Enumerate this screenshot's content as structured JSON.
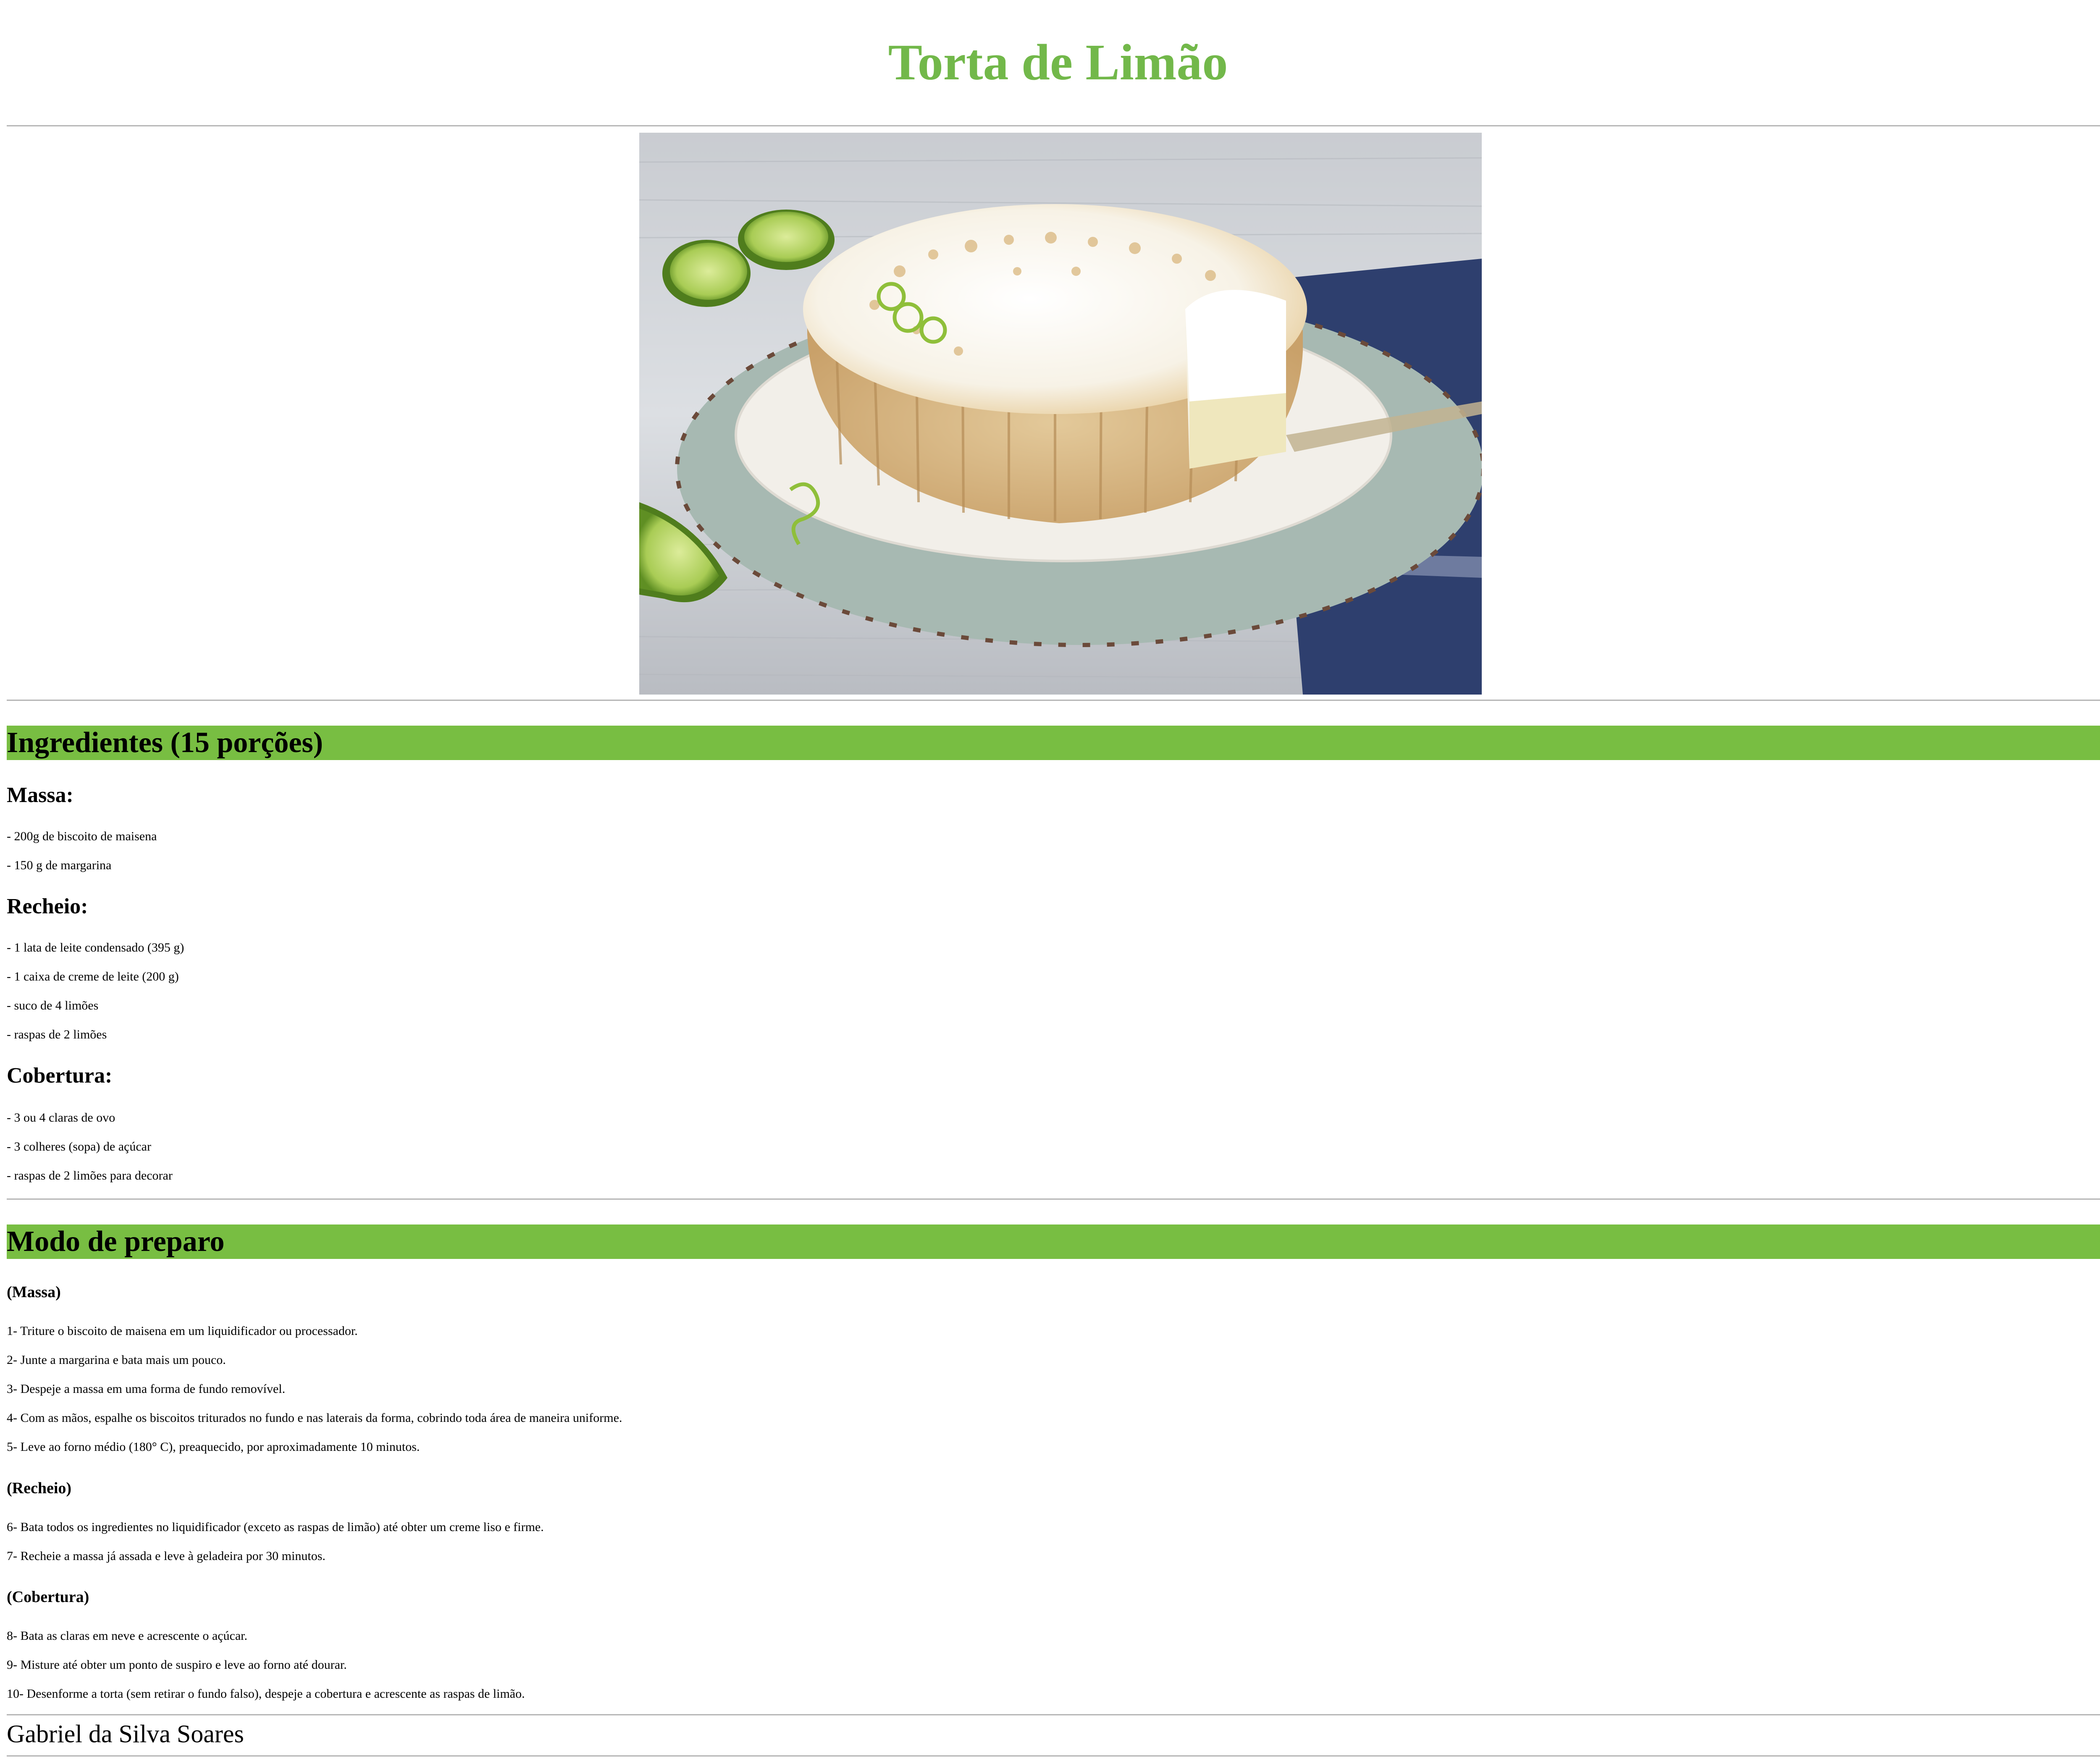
{
  "title": "Torta de Limão",
  "image": {
    "alt": "Torta de limão com merengue"
  },
  "ingredients": {
    "heading": "Ingredientes (15 porções)",
    "massa": {
      "heading": "Massa:",
      "items": [
        "- 200g de biscoito de maisena",
        "- 150 g de margarina"
      ]
    },
    "recheio": {
      "heading": "Recheio:",
      "items": [
        "- 1 lata de leite condensado (395 g)",
        "- 1 caixa de creme de leite (200 g)",
        "- suco de 4 limões",
        "- raspas de 2 limões"
      ]
    },
    "cobertura": {
      "heading": "Cobertura:",
      "items": [
        "- 3 ou 4 claras de ovo",
        "- 3 colheres (sopa) de açúcar",
        "- raspas de 2 limões para decorar"
      ]
    }
  },
  "preparation": {
    "heading": "Modo de preparo",
    "massa": {
      "heading": "(Massa)",
      "steps": [
        "1- Triture o biscoito de maisena em um liquidificador ou processador.",
        "2- Junte a margarina e bata mais um pouco.",
        "3- Despeje a massa em uma forma de fundo removível.",
        "4- Com as mãos, espalhe os biscoitos triturados no fundo e nas laterais da forma, cobrindo toda área de maneira uniforme.",
        "5- Leve ao forno médio (180° C), preaquecido, por aproximadamente 10 minutos."
      ]
    },
    "recheio": {
      "heading": "(Recheio)",
      "steps": [
        "6- Bata todos os ingredientes no liquidificador (exceto as raspas de limão) até obter um creme liso e firme.",
        "7- Recheie a massa já assada e leve à geladeira por 30 minutos."
      ]
    },
    "cobertura": {
      "heading": "(Cobertura)",
      "steps": [
        "8- Bata as claras em neve e acrescente o açúcar.",
        "9- Misture até obter um ponto de suspiro e leve ao forno até dourar.",
        "10- Desenforme a torta (sem retirar o fundo falso), despeje a cobertura e acrescente as raspas de limão."
      ]
    }
  },
  "footer": {
    "author": "Gabriel da Silva Soares"
  },
  "colors": {
    "title": "#72b84a",
    "section_bar": "#78be42",
    "rule": "#b5b5b5"
  }
}
